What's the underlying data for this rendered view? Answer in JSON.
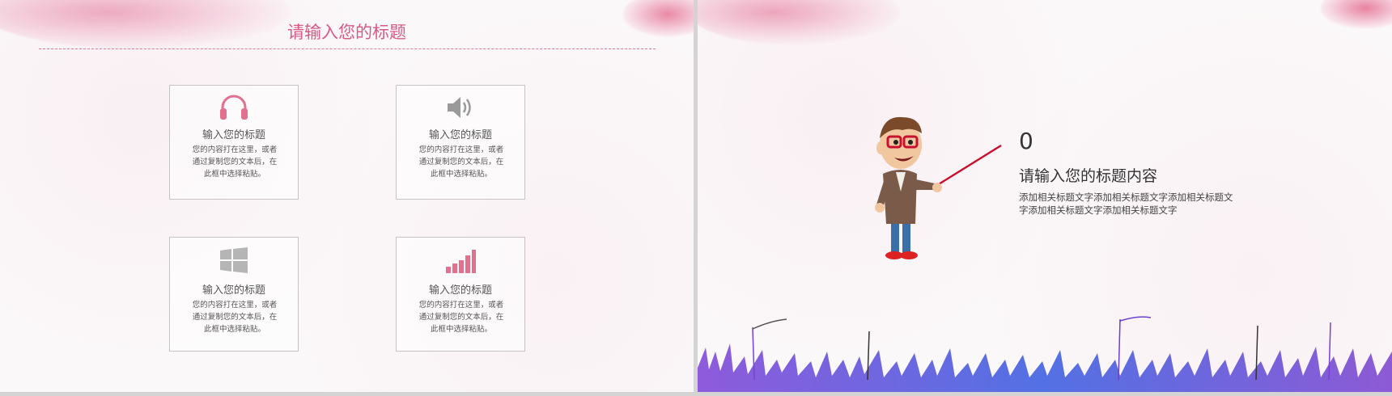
{
  "left_slide": {
    "title": "请输入您的标题",
    "cards": [
      {
        "icon": "headphones-icon",
        "title": "输入您的标题",
        "body": "您的内容打在这里，或者通过复制您的文本后，在此框中选择粘贴。"
      },
      {
        "icon": "speaker-icon",
        "title": "输入您的标题",
        "body": "您的内容打在这里，或者通过复制您的文本后，在此框中选择粘贴。"
      },
      {
        "icon": "windows-icon",
        "title": "输入您的标题",
        "body": "您的内容打在这里，或者通过复制您的文本后，在此框中选择粘贴。"
      },
      {
        "icon": "signal-bars-icon",
        "title": "输入您的标题",
        "body": "您的内容打在这里，或者通过复制您的文本后，在此框中选择粘贴。"
      }
    ]
  },
  "right_slide": {
    "number": "0",
    "heading": "请输入您的标题内容",
    "body": "添加相关标题文字添加相关标题文字添加相关标题文字添加相关标题文字添加相关标题文字"
  },
  "colors": {
    "accent_pink": "#d75a86",
    "grass_purple": "#6b3fd1",
    "grass_blue": "#2f5fe0"
  }
}
